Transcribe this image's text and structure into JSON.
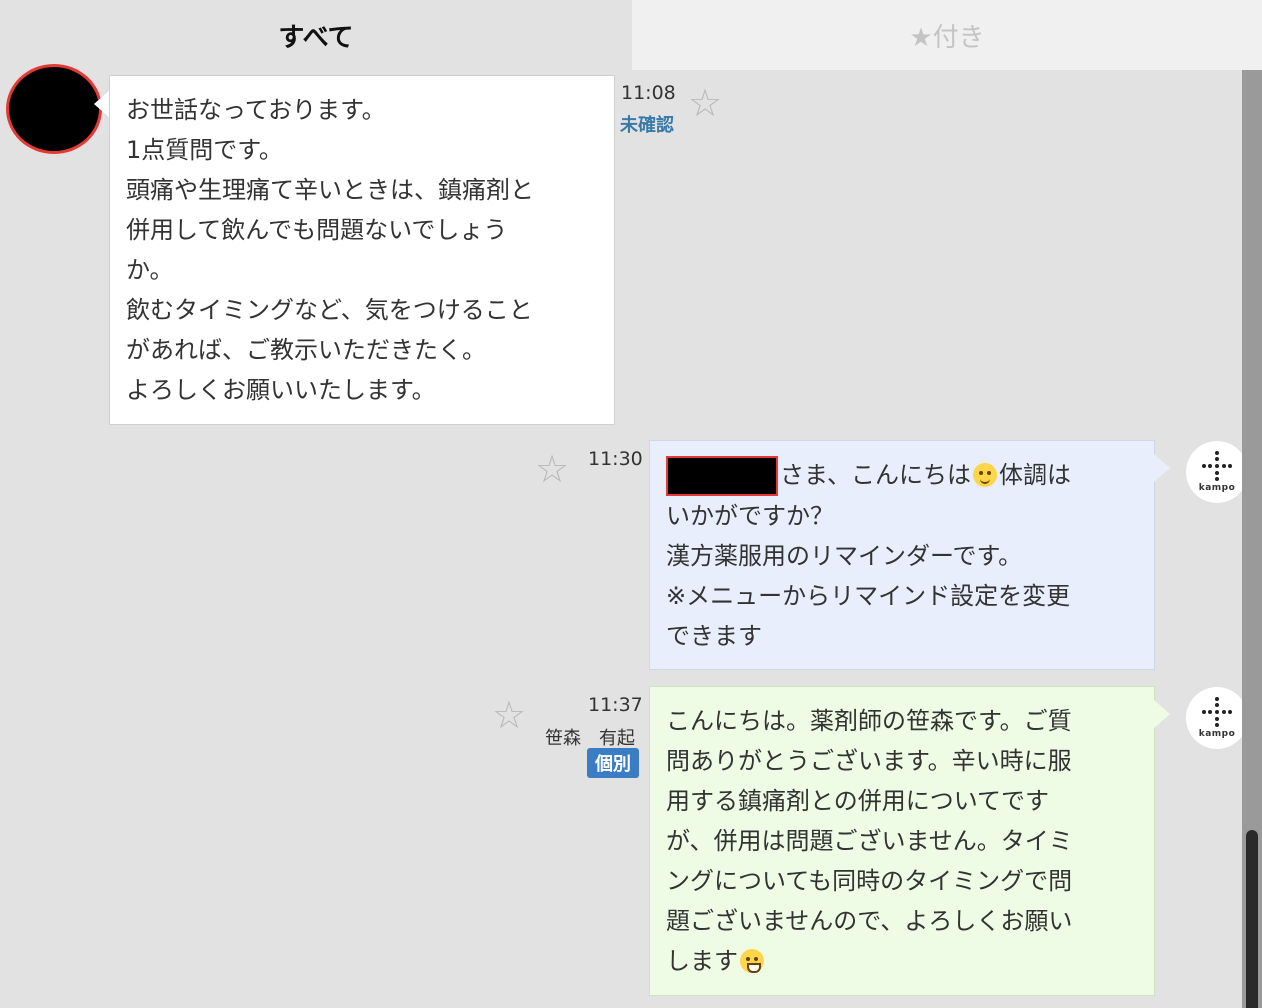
{
  "tabs": {
    "all": "すべて",
    "starred": "★付き"
  },
  "messages": {
    "m1": {
      "time": "11:08",
      "status": "未確認",
      "text": "お世話なっております。\n1点質問です。\n頭痛や生理痛て辛いときは、鎮痛剤と\n併用して飲んでも問題ないでしょう\nか。\n飲むタイミングなど、気をつけること\nがあれば、ご教示いただきたく。\nよろしくお願いいたします。"
    },
    "m2": {
      "time": "11:30",
      "text_after_name": "さま、こんにちは",
      "text_after_emoji": "体調は\nいかがですか？\n漢方薬服用のリマインダーです。\n※メニューからリマインド設定を変更\nできます"
    },
    "m3": {
      "time": "11:37",
      "staff": "笹森　有起",
      "badge": "個別",
      "text": "こんにちは。薬剤師の笹森です。ご質\n問ありがとうございます。辛い時に服\n用する鎮痛剤との併用についてです\nが、併用は問題ございません。タイミ\nングについても同時のタイミングで問\n題ございませんので、よろしくお願い\nします"
    }
  },
  "kampo_label": "kampo",
  "star_glyph": "☆",
  "colors": {
    "accent_blue": "#3b7dc4",
    "unread": "#3a7aa8",
    "redact_border": "#e53935"
  }
}
